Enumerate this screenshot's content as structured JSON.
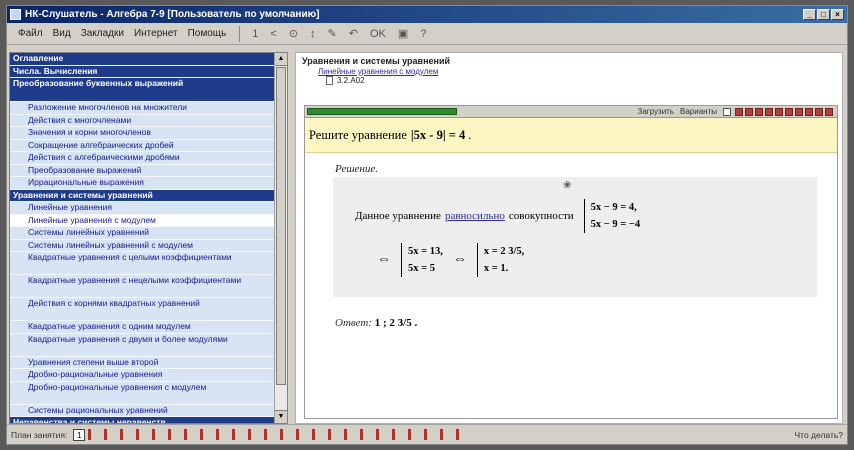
{
  "window": {
    "title": "НК-Слушатель - Алгебра 7-9 [Пользователь по умолчанию]",
    "buttons": [
      "_",
      "□",
      "×"
    ]
  },
  "menu": [
    "Файл",
    "Вид",
    "Закладки",
    "Интернет",
    "Помощь"
  ],
  "toolbar": [
    "1",
    "<",
    "⊙",
    "↕",
    "✎",
    "↶",
    "OK",
    "▣",
    "?"
  ],
  "sidebar": {
    "items": [
      {
        "label": "Оглавление",
        "type": "head"
      },
      {
        "label": "Числа. Вычисления",
        "type": "head"
      },
      {
        "label": "Преобразование буквенных выражений",
        "type": "head",
        "multi": true
      },
      {
        "label": "Разложение многочленов на множители",
        "type": "sub"
      },
      {
        "label": "Действия с многочленами",
        "type": "sub"
      },
      {
        "label": "Значения и корни многочленов",
        "type": "sub"
      },
      {
        "label": "Сокращение алгебраических дробей",
        "type": "sub"
      },
      {
        "label": "Действия с алгебраическими дробями",
        "type": "sub"
      },
      {
        "label": "Преобразование выражений",
        "type": "sub"
      },
      {
        "label": "Иррациональные выражения",
        "type": "sub"
      },
      {
        "label": "Уравнения и системы уравнений",
        "type": "head"
      },
      {
        "label": "Линейные уравнения",
        "type": "sub"
      },
      {
        "label": "Линейные уравнения с модулем",
        "type": "sub",
        "active": true
      },
      {
        "label": "Системы линейных уравнений",
        "type": "sub"
      },
      {
        "label": "Системы линейных уравнений с модулем",
        "type": "sub"
      },
      {
        "label": "Квадратные уравнения с целыми коэффициентами",
        "type": "sub",
        "multi": true
      },
      {
        "label": "Квадратные уравнения с нецелыми коэффициентами",
        "type": "sub",
        "multi": true
      },
      {
        "label": "Действия с корнями квадратных уравнений",
        "type": "sub",
        "multi": true
      },
      {
        "label": "Квадратные уравнения с одним модулем",
        "type": "sub"
      },
      {
        "label": "Квадратные уравнения с двумя и более модулями",
        "type": "sub",
        "multi": true
      },
      {
        "label": "Уравнения степени выше второй",
        "type": "sub"
      },
      {
        "label": "Дробно-рациональные уравнения",
        "type": "sub"
      },
      {
        "label": "Дробно-рациональные уравнения с модулем",
        "type": "sub",
        "multi": true
      },
      {
        "label": "Системы рациональных уравнений",
        "type": "sub"
      },
      {
        "label": "Неравенства и системы неравенств",
        "type": "head"
      }
    ]
  },
  "breadcrumb": {
    "title": "Уравнения и системы уравнений",
    "link": "Линейные уравнения с модулем",
    "num": "3.2.А02"
  },
  "task_toolbar": {
    "load": "Загрузить",
    "variants": "Варианты"
  },
  "question": {
    "prefix": "Решите уравнение",
    "equation": "|5x - 9| = 4",
    "suffix": "."
  },
  "solution": {
    "label": "Решение.",
    "mark": "❀",
    "intro": "Данное уравнение",
    "link": "равносильно",
    "after": "совокупности",
    "sys1": [
      "5x − 9 = 4,",
      "5x − 9 = −4"
    ],
    "arrow": "⇔",
    "sys2": [
      "5x = 13,",
      "5x = 5"
    ],
    "sys3": [
      "x = 2 3/5,",
      "x = 1."
    ]
  },
  "answer": {
    "label": "Ответ:",
    "value": "1 ; 2 3/5 ."
  },
  "status": {
    "plan_label": "План занятия:",
    "current": "1",
    "help": "Что делать?"
  }
}
